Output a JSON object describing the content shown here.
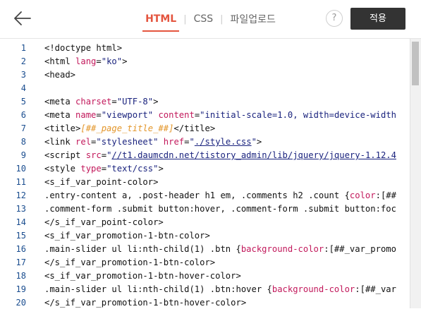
{
  "tabs": [
    {
      "label": "HTML",
      "active": true
    },
    {
      "label": "CSS",
      "active": false
    },
    {
      "label": "파일업로드",
      "active": false
    }
  ],
  "help_label": "?",
  "apply_label": "적용",
  "accent_color": "#e4553f",
  "code_lines": [
    {
      "n": "1",
      "parts": [
        {
          "t": "<!doctype html>",
          "c": "t-tag"
        }
      ]
    },
    {
      "n": "2",
      "parts": [
        {
          "t": "<html ",
          "c": "t-tag"
        },
        {
          "t": "lang",
          "c": "t-attr"
        },
        {
          "t": "=",
          "c": "t-tag"
        },
        {
          "t": "\"ko\"",
          "c": "t-str"
        },
        {
          "t": ">",
          "c": "t-tag"
        }
      ]
    },
    {
      "n": "3",
      "parts": [
        {
          "t": "<head>",
          "c": "t-tag"
        }
      ]
    },
    {
      "n": "4",
      "parts": []
    },
    {
      "n": "5",
      "parts": [
        {
          "t": "<meta ",
          "c": "t-tag"
        },
        {
          "t": "charset",
          "c": "t-attr"
        },
        {
          "t": "=",
          "c": "t-tag"
        },
        {
          "t": "\"UTF-8\"",
          "c": "t-str"
        },
        {
          "t": ">",
          "c": "t-tag"
        }
      ]
    },
    {
      "n": "6",
      "parts": [
        {
          "t": "<meta ",
          "c": "t-tag"
        },
        {
          "t": "name",
          "c": "t-attr"
        },
        {
          "t": "=",
          "c": "t-tag"
        },
        {
          "t": "\"viewport\"",
          "c": "t-str"
        },
        {
          "t": " ",
          "c": "t-tag"
        },
        {
          "t": "content",
          "c": "t-attr"
        },
        {
          "t": "=",
          "c": "t-tag"
        },
        {
          "t": "\"initial-scale=1.0, width=device-width",
          "c": "t-str"
        }
      ]
    },
    {
      "n": "7",
      "parts": [
        {
          "t": "<title>",
          "c": "t-tag"
        },
        {
          "t": "[##_page_title_##]",
          "c": "t-var"
        },
        {
          "t": "</title>",
          "c": "t-tag"
        }
      ]
    },
    {
      "n": "8",
      "parts": [
        {
          "t": "<link ",
          "c": "t-tag"
        },
        {
          "t": "rel",
          "c": "t-attr"
        },
        {
          "t": "=",
          "c": "t-tag"
        },
        {
          "t": "\"stylesheet\"",
          "c": "t-str"
        },
        {
          "t": " ",
          "c": "t-tag"
        },
        {
          "t": "href",
          "c": "t-attr"
        },
        {
          "t": "=",
          "c": "t-tag"
        },
        {
          "t": "\"",
          "c": "t-str"
        },
        {
          "t": "./style.css",
          "c": "t-url"
        },
        {
          "t": "\"",
          "c": "t-str"
        },
        {
          "t": ">",
          "c": "t-tag"
        }
      ]
    },
    {
      "n": "9",
      "parts": [
        {
          "t": "<script ",
          "c": "t-tag"
        },
        {
          "t": "src",
          "c": "t-attr"
        },
        {
          "t": "=",
          "c": "t-tag"
        },
        {
          "t": "\"",
          "c": "t-str"
        },
        {
          "t": "//t1.daumcdn.net/tistory_admin/lib/jquery/jquery-1.12.4",
          "c": "t-url"
        }
      ]
    },
    {
      "n": "10",
      "parts": [
        {
          "t": "<style ",
          "c": "t-tag"
        },
        {
          "t": "type",
          "c": "t-attr"
        },
        {
          "t": "=",
          "c": "t-tag"
        },
        {
          "t": "\"text/css\"",
          "c": "t-str"
        },
        {
          "t": ">",
          "c": "t-tag"
        }
      ]
    },
    {
      "n": "11",
      "parts": [
        {
          "t": "<s_if_var_point-color>",
          "c": "t-tag"
        }
      ]
    },
    {
      "n": "12",
      "parts": [
        {
          "t": ".entry-content a, .post-header h1 em, .comments h2 .count {",
          "c": "t-sel"
        },
        {
          "t": "color",
          "c": "t-prop"
        },
        {
          "t": ":[##",
          "c": "t-sel"
        }
      ]
    },
    {
      "n": "13",
      "parts": [
        {
          "t": ".comment-form .submit button:hover, .comment-form .submit button:foc",
          "c": "t-sel"
        }
      ]
    },
    {
      "n": "14",
      "parts": [
        {
          "t": "</s_if_var_point-color>",
          "c": "t-tag"
        }
      ]
    },
    {
      "n": "15",
      "parts": [
        {
          "t": "<s_if_var_promotion-1-btn-color>",
          "c": "t-tag"
        }
      ]
    },
    {
      "n": "16",
      "parts": [
        {
          "t": ".main-slider ul li:nth-child(1) .btn {",
          "c": "t-sel"
        },
        {
          "t": "background-color",
          "c": "t-prop"
        },
        {
          "t": ":[##_var_promo",
          "c": "t-sel"
        }
      ]
    },
    {
      "n": "17",
      "parts": [
        {
          "t": "</s_if_var_promotion-1-btn-color>",
          "c": "t-tag"
        }
      ]
    },
    {
      "n": "18",
      "parts": [
        {
          "t": "<s_if_var_promotion-1-btn-hover-color>",
          "c": "t-tag"
        }
      ]
    },
    {
      "n": "19",
      "parts": [
        {
          "t": ".main-slider ul li:nth-child(1) .btn:hover {",
          "c": "t-sel"
        },
        {
          "t": "background-color",
          "c": "t-prop"
        },
        {
          "t": ":[##_var",
          "c": "t-sel"
        }
      ]
    },
    {
      "n": "20",
      "parts": [
        {
          "t": "</s_if_var_promotion-1-btn-hover-color>",
          "c": "t-tag"
        }
      ]
    }
  ]
}
